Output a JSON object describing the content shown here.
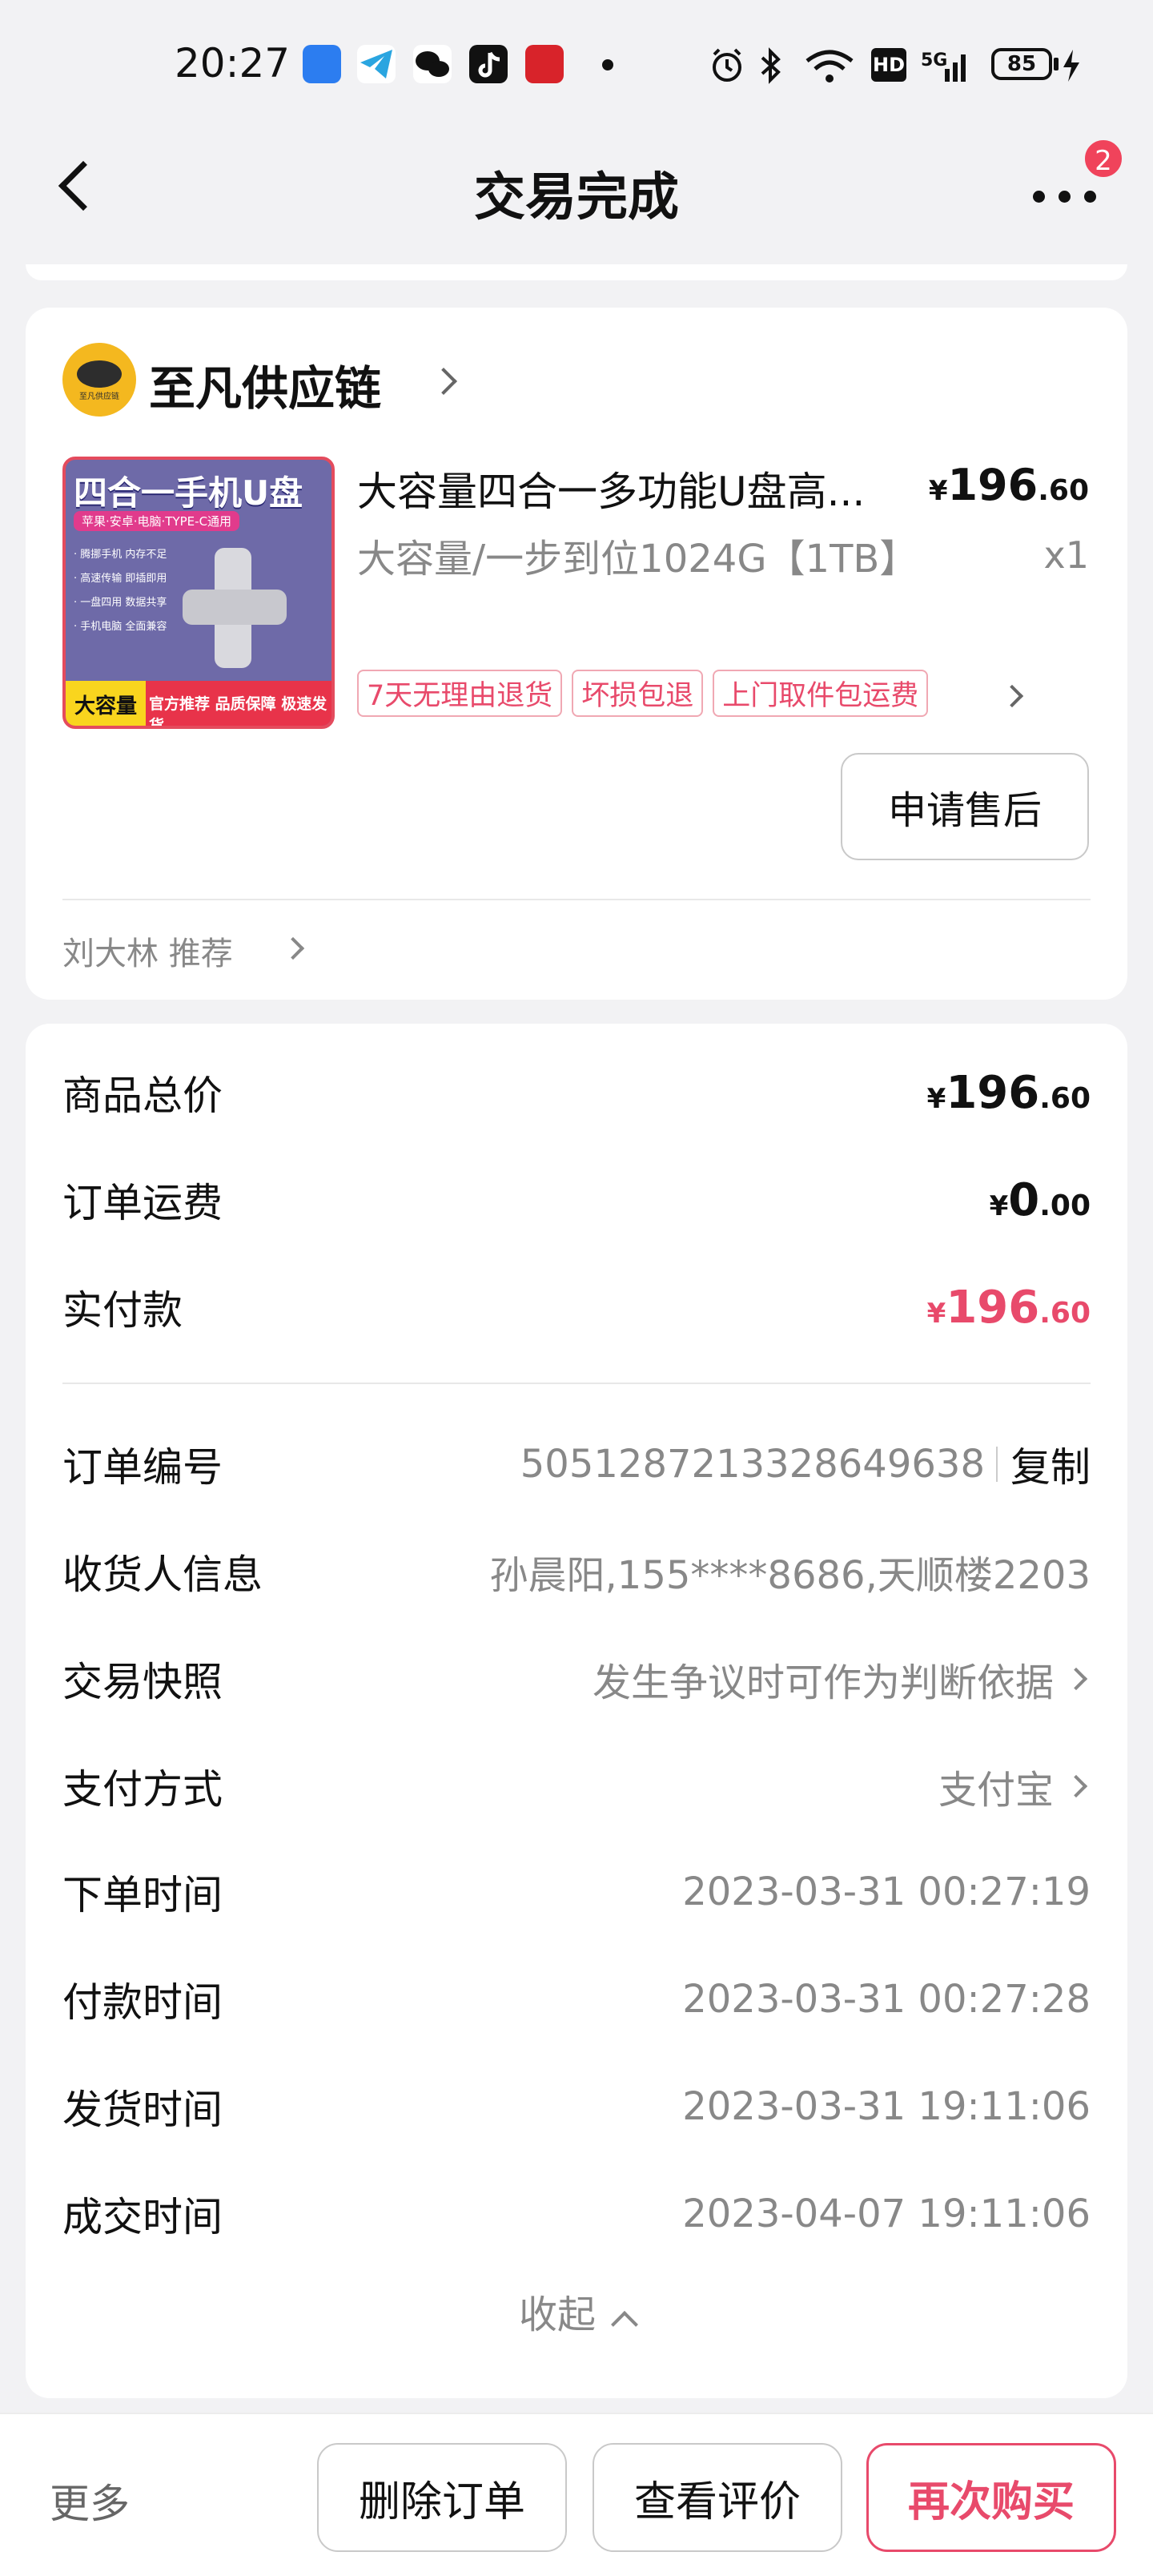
{
  "status_bar": {
    "time": "20:27",
    "battery": "85",
    "signal": "5G",
    "hd": "HD",
    "icons": [
      "bluetooth-icon",
      "wifi-icon",
      "alarm-icon",
      "signal-icon",
      "charging-icon"
    ],
    "apps": [
      "app-blue-icon",
      "telegram-icon",
      "wechat-icon",
      "tiktok-icon",
      "app-red-icon"
    ]
  },
  "header": {
    "title": "交易完成",
    "badge_count": "2"
  },
  "shop": {
    "name": "至凡供应链",
    "logo_text": "至凡供应链"
  },
  "product": {
    "thumb": {
      "title": "四合一手机U盘",
      "subtitle": "苹果·安卓·电脑·TYPE-C通用",
      "features": [
        "· 腾挪手机 内存不足",
        "· 高速传输 即插即用",
        "· 一盘四用 数据共享",
        "· 手机电脑 全面兼容"
      ],
      "bar_label": "大容量",
      "bar_text": "官方推荐 品质保障 极速发货"
    },
    "title": "大容量四合一多功能U盘高...",
    "price": {
      "yen": "¥",
      "int": "196",
      "dec": ".60"
    },
    "spec": "大容量/一步到位1024G【1TB】",
    "qty": "x1",
    "tags": [
      "7天无理由退货",
      "坏损包退",
      "上门取件包运费"
    ],
    "after_sale_button": "申请售后"
  },
  "recommend": "刘大林 推荐",
  "summary": {
    "total_label": "商品总价",
    "total": {
      "yen": "¥",
      "int": "196",
      "dec": ".60"
    },
    "shipping_label": "订单运费",
    "shipping": {
      "yen": "¥",
      "int": "0",
      "dec": ".00"
    },
    "paid_label": "实付款",
    "paid": {
      "yen": "¥",
      "int": "196",
      "dec": ".60"
    }
  },
  "details": {
    "order_no_label": "订单编号",
    "order_no": "5051287213328649638",
    "copy_label": "复制",
    "receiver_label": "收货人信息",
    "receiver": "孙晨阳,155****8686,天顺楼2203",
    "snapshot_label": "交易快照",
    "snapshot": "发生争议时可作为判断依据",
    "payment_label": "支付方式",
    "payment": "支付宝",
    "order_time_label": "下单时间",
    "order_time": "2023-03-31 00:27:19",
    "pay_time_label": "付款时间",
    "pay_time": "2023-03-31 00:27:28",
    "ship_time_label": "发货时间",
    "ship_time": "2023-03-31 19:11:06",
    "deal_time_label": "成交时间",
    "deal_time": "2023-04-07 19:11:06",
    "collapse_label": "收起"
  },
  "bottom": {
    "more": "更多",
    "delete": "删除订单",
    "review": "查看评价",
    "rebuy": "再次购买"
  },
  "colors": {
    "accent": "#e84a6b",
    "badge": "#f0435b",
    "background": "#f2f2f4"
  }
}
